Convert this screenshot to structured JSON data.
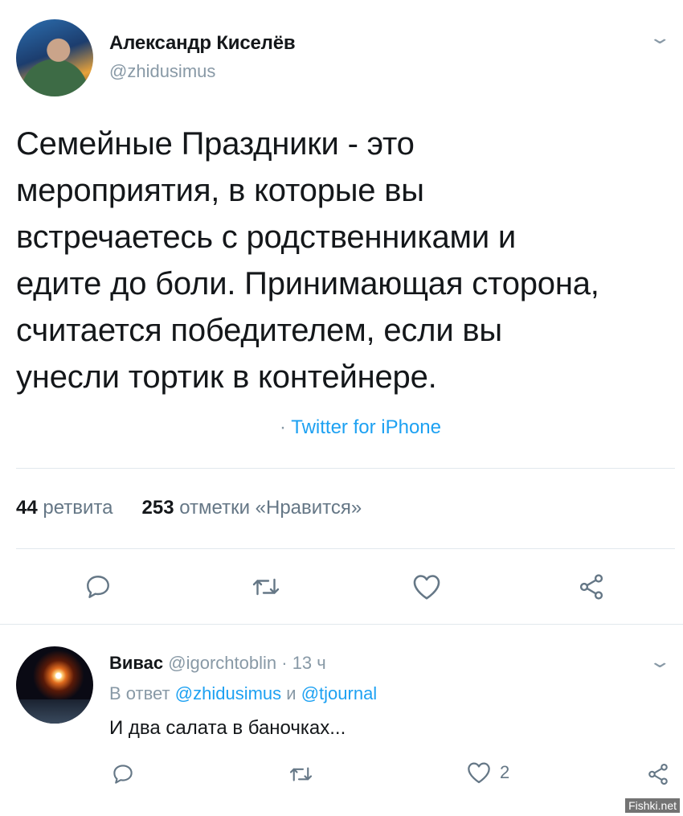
{
  "tweet": {
    "author_name": "Александр Киселёв",
    "author_handle": "@zhidusimus",
    "text": "Семейные Праздники - это\nмероприятия, в которые вы\nвстречаетесь с родственниками и\nедите до боли.  Принимающая сторона,\nсчитается победителем, если вы\nунесли тортик в контейнере.",
    "source_separator": "·",
    "source": "Twitter for iPhone",
    "retweets_count": "44",
    "retweets_label": "ретвита",
    "likes_count": "253",
    "likes_label": "отметки «Нравится»"
  },
  "reply": {
    "author_name": "Вивас",
    "author_handle": "@igorchtoblin",
    "separator": "·",
    "time": "13 ч",
    "reply_to_prefix": "В ответ",
    "reply_to_user1": "@zhidusimus",
    "reply_to_and": "и",
    "reply_to_user2": "@tjournal",
    "text": "И два салата в баночках...",
    "like_count": "2"
  },
  "icons": {
    "menu": "chevron-down-icon",
    "reply": "speech-bubble-icon",
    "retweet": "retweet-arrows-icon",
    "like": "heart-icon",
    "share": "share-nodes-icon"
  },
  "watermark": "Fishki.net",
  "colors": {
    "link": "#1da1f2",
    "muted": "#8899a6",
    "text": "#14171a",
    "divider": "#e1e8ed"
  }
}
